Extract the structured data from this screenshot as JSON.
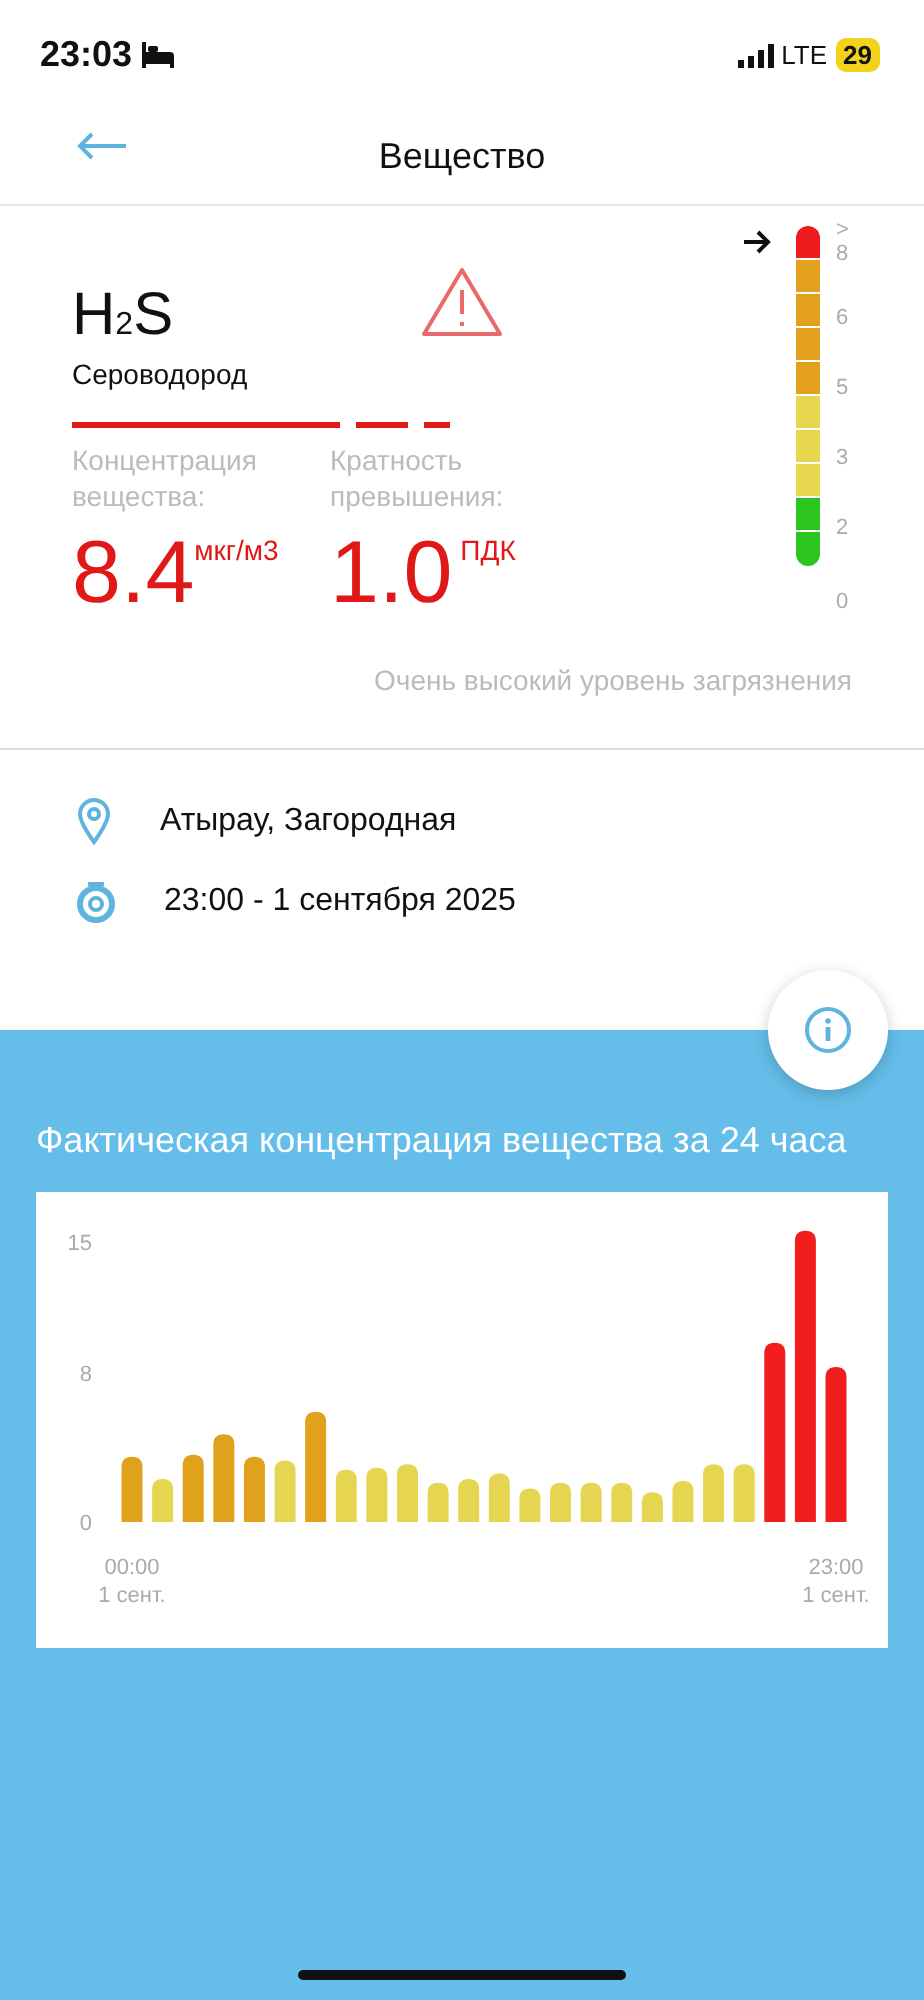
{
  "status_bar": {
    "time": "23:03",
    "network": "LTE",
    "battery": "29"
  },
  "header": {
    "title": "Вещество"
  },
  "substance": {
    "formula": "H$_{2}$S",
    "name": "Сероводород",
    "concentration": {
      "label": "Концентрация вещества:",
      "value": "8.4",
      "unit": "мкг/м3"
    },
    "excess": {
      "label": "Кратность превышения:",
      "value": "1.0",
      "unit": "ПДК"
    },
    "status": "Очень высокий уровень загрязнения",
    "scale": {
      "segments": [
        {
          "color": "#ee1c1c",
          "selected": true
        },
        {
          "color": "#e3a11e",
          "selected": false
        },
        {
          "color": "#e3a11e",
          "selected": false
        },
        {
          "color": "#e3a11e",
          "selected": false
        },
        {
          "color": "#e3a11e",
          "selected": false
        },
        {
          "color": "#e8d64e",
          "selected": false
        },
        {
          "color": "#e8d64e",
          "selected": false
        },
        {
          "color": "#e8d64e",
          "selected": false
        },
        {
          "color": "#2cc41e",
          "selected": false
        },
        {
          "color": "#2cc41e",
          "selected": false
        }
      ],
      "labels": [
        ">",
        "8",
        "6",
        "5",
        "3",
        "2",
        "0"
      ]
    }
  },
  "location": "Атырау, Загородная",
  "datetime": "23:00 - 1 сентября 2025",
  "chart_section": {
    "title": "Фактическая концентрация вещества за 24 часа",
    "chart_data": {
      "type": "bar",
      "categories": [
        "00:00\n1 сент.",
        null,
        null,
        null,
        null,
        null,
        null,
        null,
        null,
        null,
        null,
        null,
        null,
        null,
        null,
        null,
        null,
        null,
        null,
        null,
        null,
        null,
        null,
        "23:00\n1 сент."
      ],
      "series": [
        {
          "color": "#e0a11c",
          "values": [
            3.5,
            null,
            3.6,
            4.7,
            3.5,
            null,
            5.9,
            null,
            null,
            null,
            null,
            null,
            null,
            null,
            null,
            null,
            null,
            null,
            null,
            null,
            null,
            null,
            null,
            null
          ]
        },
        {
          "color": "#e6d550",
          "values": [
            null,
            2.3,
            null,
            null,
            null,
            3.3,
            null,
            2.8,
            2.9,
            3.1,
            2.1,
            2.3,
            2.6,
            1.8,
            2.1,
            2.1,
            2.1,
            1.6,
            2.2,
            3.1,
            3.1,
            null,
            null,
            null
          ]
        },
        {
          "color": "#f21d1d",
          "values": [
            null,
            null,
            null,
            null,
            null,
            null,
            null,
            null,
            null,
            null,
            null,
            null,
            null,
            null,
            null,
            null,
            null,
            null,
            null,
            null,
            null,
            9.6,
            15.6,
            8.3
          ]
        }
      ],
      "ylim": [
        0,
        16
      ],
      "yticks": [
        0,
        8,
        15
      ]
    }
  }
}
